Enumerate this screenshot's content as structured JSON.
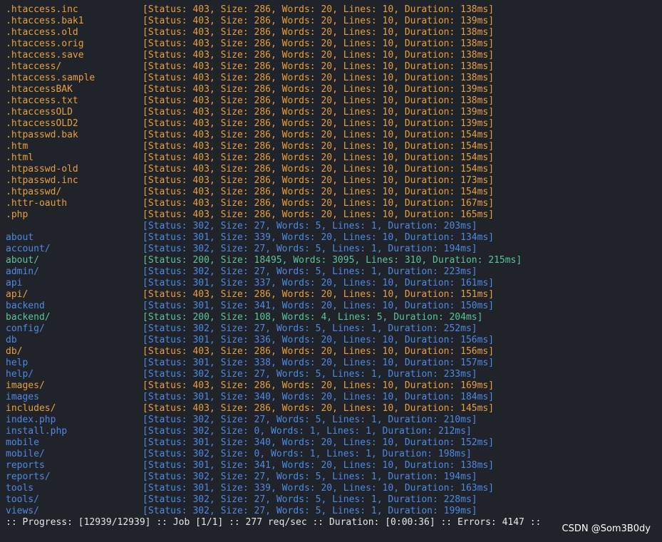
{
  "colors": {
    "background": "#21232b",
    "status_403": "#e6a13b",
    "status_30x": "#4f89e0",
    "status_200": "#5cc49a",
    "text": "#e6e6e6"
  },
  "rows": [
    {
      "path": ".htaccess.inc",
      "status": "[Status: 403, Size: 286, Words: 20, Lines: 10, Duration: 138ms]",
      "color": "orange"
    },
    {
      "path": ".htaccess.bak1",
      "status": "[Status: 403, Size: 286, Words: 20, Lines: 10, Duration: 139ms]",
      "color": "orange"
    },
    {
      "path": ".htaccess.old",
      "status": "[Status: 403, Size: 286, Words: 20, Lines: 10, Duration: 138ms]",
      "color": "orange"
    },
    {
      "path": ".htaccess.orig",
      "status": "[Status: 403, Size: 286, Words: 20, Lines: 10, Duration: 138ms]",
      "color": "orange"
    },
    {
      "path": ".htaccess.save",
      "status": "[Status: 403, Size: 286, Words: 20, Lines: 10, Duration: 138ms]",
      "color": "orange"
    },
    {
      "path": ".htaccess/",
      "status": "[Status: 403, Size: 286, Words: 20, Lines: 10, Duration: 138ms]",
      "color": "orange"
    },
    {
      "path": ".htaccess.sample",
      "status": "[Status: 403, Size: 286, Words: 20, Lines: 10, Duration: 138ms]",
      "color": "orange"
    },
    {
      "path": ".htaccessBAK",
      "status": "[Status: 403, Size: 286, Words: 20, Lines: 10, Duration: 139ms]",
      "color": "orange"
    },
    {
      "path": ".htaccess.txt",
      "status": "[Status: 403, Size: 286, Words: 20, Lines: 10, Duration: 138ms]",
      "color": "orange"
    },
    {
      "path": ".htaccessOLD",
      "status": "[Status: 403, Size: 286, Words: 20, Lines: 10, Duration: 139ms]",
      "color": "orange"
    },
    {
      "path": ".htaccessOLD2",
      "status": "[Status: 403, Size: 286, Words: 20, Lines: 10, Duration: 139ms]",
      "color": "orange"
    },
    {
      "path": ".htpasswd.bak",
      "status": "[Status: 403, Size: 286, Words: 20, Lines: 10, Duration: 154ms]",
      "color": "orange"
    },
    {
      "path": ".htm",
      "status": "[Status: 403, Size: 286, Words: 20, Lines: 10, Duration: 154ms]",
      "color": "orange"
    },
    {
      "path": ".html",
      "status": "[Status: 403, Size: 286, Words: 20, Lines: 10, Duration: 154ms]",
      "color": "orange"
    },
    {
      "path": ".htpasswd-old",
      "status": "[Status: 403, Size: 286, Words: 20, Lines: 10, Duration: 154ms]",
      "color": "orange"
    },
    {
      "path": ".htpasswd.inc",
      "status": "[Status: 403, Size: 286, Words: 20, Lines: 10, Duration: 173ms]",
      "color": "orange"
    },
    {
      "path": ".htpasswd/",
      "status": "[Status: 403, Size: 286, Words: 20, Lines: 10, Duration: 154ms]",
      "color": "orange"
    },
    {
      "path": ".httr-oauth",
      "status": "[Status: 403, Size: 286, Words: 20, Lines: 10, Duration: 167ms]",
      "color": "orange"
    },
    {
      "path": ".php",
      "status": "[Status: 403, Size: 286, Words: 20, Lines: 10, Duration: 165ms]",
      "color": "orange"
    },
    {
      "path": "",
      "status": "[Status: 302, Size: 27, Words: 5, Lines: 1, Duration: 203ms]",
      "color": "blue"
    },
    {
      "path": "about",
      "status": "[Status: 301, Size: 339, Words: 20, Lines: 10, Duration: 134ms]",
      "color": "blue"
    },
    {
      "path": "account/",
      "status": "[Status: 302, Size: 27, Words: 5, Lines: 1, Duration: 194ms]",
      "color": "blue"
    },
    {
      "path": "about/",
      "status": "[Status: 200, Size: 18495, Words: 3095, Lines: 310, Duration: 215ms]",
      "color": "green"
    },
    {
      "path": "admin/",
      "status": "[Status: 302, Size: 27, Words: 5, Lines: 1, Duration: 223ms]",
      "color": "blue"
    },
    {
      "path": "api",
      "status": "[Status: 301, Size: 337, Words: 20, Lines: 10, Duration: 161ms]",
      "color": "blue"
    },
    {
      "path": "api/",
      "status": "[Status: 403, Size: 286, Words: 20, Lines: 10, Duration: 151ms]",
      "color": "orange"
    },
    {
      "path": "backend",
      "status": "[Status: 301, Size: 341, Words: 20, Lines: 10, Duration: 150ms]",
      "color": "blue"
    },
    {
      "path": "backend/",
      "status": "[Status: 200, Size: 108, Words: 4, Lines: 5, Duration: 204ms]",
      "color": "green"
    },
    {
      "path": "config/",
      "status": "[Status: 302, Size: 27, Words: 5, Lines: 1, Duration: 252ms]",
      "color": "blue"
    },
    {
      "path": "db",
      "status": "[Status: 301, Size: 336, Words: 20, Lines: 10, Duration: 156ms]",
      "color": "blue"
    },
    {
      "path": "db/",
      "status": "[Status: 403, Size: 286, Words: 20, Lines: 10, Duration: 156ms]",
      "color": "orange"
    },
    {
      "path": "help",
      "status": "[Status: 301, Size: 338, Words: 20, Lines: 10, Duration: 157ms]",
      "color": "blue"
    },
    {
      "path": "help/",
      "status": "[Status: 302, Size: 27, Words: 5, Lines: 1, Duration: 233ms]",
      "color": "blue"
    },
    {
      "path": "images/",
      "status": "[Status: 403, Size: 286, Words: 20, Lines: 10, Duration: 169ms]",
      "color": "orange"
    },
    {
      "path": "images",
      "status": "[Status: 301, Size: 340, Words: 20, Lines: 10, Duration: 184ms]",
      "color": "blue"
    },
    {
      "path": "includes/",
      "status": "[Status: 403, Size: 286, Words: 20, Lines: 10, Duration: 145ms]",
      "color": "orange"
    },
    {
      "path": "index.php",
      "status": "[Status: 302, Size: 27, Words: 5, Lines: 1, Duration: 210ms]",
      "color": "blue"
    },
    {
      "path": "install.php",
      "status": "[Status: 302, Size: 0, Words: 1, Lines: 1, Duration: 212ms]",
      "color": "blue"
    },
    {
      "path": "mobile",
      "status": "[Status: 301, Size: 340, Words: 20, Lines: 10, Duration: 152ms]",
      "color": "blue"
    },
    {
      "path": "mobile/",
      "status": "[Status: 302, Size: 0, Words: 1, Lines: 1, Duration: 198ms]",
      "color": "blue"
    },
    {
      "path": "reports",
      "status": "[Status: 301, Size: 341, Words: 20, Lines: 10, Duration: 138ms]",
      "color": "blue"
    },
    {
      "path": "reports/",
      "status": "[Status: 302, Size: 27, Words: 5, Lines: 1, Duration: 194ms]",
      "color": "blue"
    },
    {
      "path": "tools",
      "status": "[Status: 301, Size: 339, Words: 20, Lines: 10, Duration: 163ms]",
      "color": "blue"
    },
    {
      "path": "tools/",
      "status": "[Status: 302, Size: 27, Words: 5, Lines: 1, Duration: 228ms]",
      "color": "blue"
    },
    {
      "path": "views/",
      "status": "[Status: 302, Size: 27, Words: 5, Lines: 1, Duration: 199ms]",
      "color": "blue"
    }
  ],
  "progress_line": ":: Progress: [12939/12939] :: Job [1/1] :: 277 req/sec :: Duration: [0:00:36] :: Errors: 4147 ::",
  "watermark": "CSDN @Som3B0dy"
}
